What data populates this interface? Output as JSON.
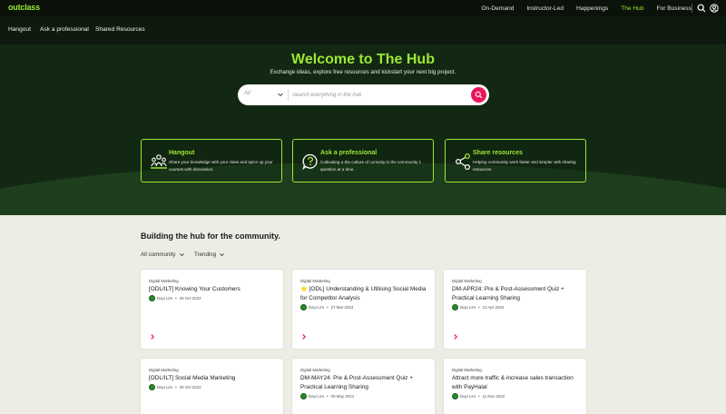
{
  "brand": {
    "logo": "outclass"
  },
  "topnav": {
    "items": [
      {
        "label": "On-Demand"
      },
      {
        "label": "Instructor-Led"
      },
      {
        "label": "Happenings"
      },
      {
        "label": "The Hub",
        "active": true
      },
      {
        "label": "For Business"
      }
    ],
    "icons": [
      "search-icon",
      "user-icon"
    ]
  },
  "subnav": {
    "items": [
      {
        "label": "Hangout"
      },
      {
        "label": "Ask a professional"
      },
      {
        "label": "Shared Resources"
      }
    ]
  },
  "hero": {
    "title": "Welcome to The Hub",
    "subtitle": "Exchange ideas, explore free resources and kickstart your next big project.",
    "search": {
      "scope_value": "All",
      "placeholder": "Search everything in the hub"
    }
  },
  "features": [
    {
      "icon": "people-icon",
      "title": "Hangout",
      "description": "Share your knowledge with your class and spice up your courses with discussion."
    },
    {
      "icon": "question-bubble-icon",
      "title": "Ask a professional",
      "description": "Cultivating a the culture of curiosity in the community 1 question at a time."
    },
    {
      "icon": "share-icon",
      "title": "Share resources",
      "description": "Helping community work faster and simpler with sharing resources."
    }
  ],
  "community": {
    "title": "Building the hub for the community.",
    "filters": [
      {
        "label": "All community"
      },
      {
        "label": "Trending"
      }
    ],
    "posts": [
      {
        "category": "Digital Marketing",
        "title": "[ODL/ILT] Knowing Your Customers",
        "author": "Dayi Lim",
        "date": "28 Oct 2022"
      },
      {
        "category": "Digital Marketing",
        "title": "⭐ [ODL] Understanding & Utilising Social Media for Competitor Analysis",
        "author": "Dayi Lim",
        "date": "27 Mar 2023"
      },
      {
        "category": "Digital Marketing",
        "title": "DM-APR24: Pre & Post-Assessment Quiz + Practical Learning Sharing",
        "author": "Dayi Lim",
        "date": "12 Apr 2024"
      },
      {
        "category": "Digital Marketing",
        "title": "[ODL/ILT] Social Media Marketing",
        "author": "Dayi Lim",
        "date": "28 Oct 2022"
      },
      {
        "category": "Digital Marketing",
        "title": "DM-MAY24: Pre & Post-Assessment Quiz + Practical Learning Sharing",
        "author": "Dayi Lim",
        "date": "09 May 2024"
      },
      {
        "category": "Digital Marketing",
        "title": "Attract more traffic & increase sales transaction with PayHalal",
        "author": "Dayi Lim",
        "date": "11 Nov 2022"
      }
    ]
  },
  "colors": {
    "accent": "#9be834",
    "hero_bg": "#132813",
    "search_button": "#e8175d",
    "page_bg": "#eceee5"
  }
}
